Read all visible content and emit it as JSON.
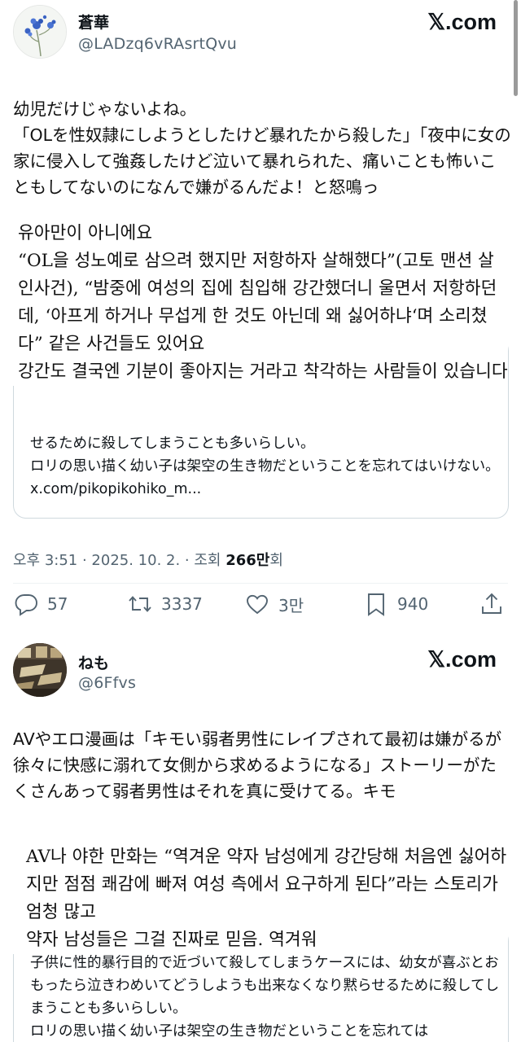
{
  "post1": {
    "display_name": "蒼華",
    "handle": "@LADzq6vRAsrtQvu",
    "source_badge": "𝕏.com",
    "body_ja": "幼児だけじゃないよね。\n「OLを性奴隷にしようとしたけど暴れたから殺した」「夜中に女の家に侵入して強姦したけど泣いて暴れられた、痛いことも怖いこともしてないのになんで嫌がるんだよ！と怒鳴っ",
    "body_ko": "유아만이 아니에요\n“OL을 성노예로 삼으려 했지만 저항하자 살해했다”(고토 맨션 살인사건), “밤중에 여성의 집에 침입해 강간했더니 울면서 저항하던데, ‘아프게 하거나 무섭게 한 것도 아닌데 왜 싫어하냐‘며 소리쳤다” 같은 사건들도 있어요\n강간도 결국엔 기분이 좋아지는 거라고 착각하는 사람들이 있습니다",
    "quote_text": "せるために殺してしまうことも多いらしい。\nロリの思い描く幼い子は架空の生き物だということを忘れてはいけない。x.com/pikopikohiko_m...",
    "meta_prefix": "오후 3:51 · 2025. 10. 2. · 조회 ",
    "views": "266만",
    "meta_suffix": "회",
    "actions": {
      "replies": "57",
      "retweets": "3337",
      "likes": "3만",
      "bookmarks": "940"
    }
  },
  "post2": {
    "display_name": "ねも",
    "handle": "@6Ffvs",
    "source_badge": "𝕏.com",
    "body_ja": "AVやエロ漫画は「キモい弱者男性にレイプされて最初は嫌がるが徐々に快感に溺れて女側から求めるようになる」ストーリーがたくさんあって弱者男性はそれを真に受けてる。キモ",
    "body_ko": "AV나 야한 만화는 “역겨운 약자 남성에게 강간당해 처음엔 싫어하지만 점점 쾌감에 빠져 여성 측에서 요구하게 된다”라는 스토리가 엄청 많고\n약자 남성들은 그걸 진짜로 믿음. 역겨워",
    "quote_text": "子供に性的暴行目的で近づいて殺してしまうケースには、幼女が喜ぶとおもったら泣きわめいてどうしようも出来なくなり黙らせるために殺してしまうことも多いらしい。\nロリの思い描く幼い子は架空の生き物だということを忘れては"
  }
}
